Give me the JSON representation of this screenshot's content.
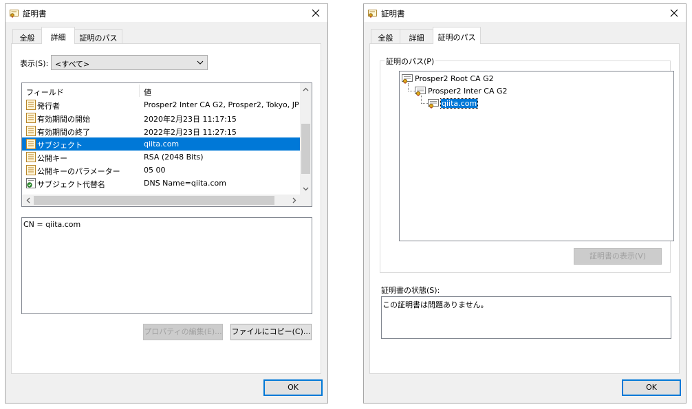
{
  "dialogs": [
    {
      "title": "証明書",
      "tabs": [
        "全般",
        "詳細",
        "証明のパス"
      ],
      "active_tab": "詳細",
      "show_label": "表示(S):",
      "show_value": "<すべて>",
      "list_headers": {
        "field": "フィールド",
        "value": "値"
      },
      "rows": [
        {
          "field": "発行者",
          "value": "Prosper2 Inter CA G2, Prosper2, Tokyo, JP",
          "icon": "certificate-field-icon"
        },
        {
          "field": "有効期間の開始",
          "value": "2020年2月23日 11:17:15",
          "icon": "certificate-field-icon"
        },
        {
          "field": "有効期間の終了",
          "value": "2022年2月23日 11:27:15",
          "icon": "certificate-field-icon"
        },
        {
          "field": "サブジェクト",
          "value": "qiita.com",
          "icon": "certificate-field-icon",
          "selected": true
        },
        {
          "field": "公開キー",
          "value": "RSA (2048 Bits)",
          "icon": "certificate-field-icon"
        },
        {
          "field": "公開キーのパラメーター",
          "value": "05 00",
          "icon": "certificate-field-icon"
        },
        {
          "field": "サブジェクト代替名",
          "value": "DNS Name=qiita.com",
          "icon": "certificate-extension-icon"
        }
      ],
      "detail_text": "CN = qiita.com",
      "buttons": {
        "edit_properties": "プロパティの編集(E)...",
        "copy_to_file": "ファイルにコピー(C)...",
        "ok": "OK"
      }
    },
    {
      "title": "証明書",
      "tabs": [
        "全般",
        "詳細",
        "証明のパス"
      ],
      "active_tab": "証明のパス",
      "path_label": "証明のパス(P)",
      "path": [
        {
          "name": "Prosper2 Root CA G2",
          "level": 0
        },
        {
          "name": "Prosper2 Inter CA G2",
          "level": 1
        },
        {
          "name": "qiita.com",
          "level": 2,
          "selected": true
        }
      ],
      "view_cert_button": "証明書の表示(V)",
      "status_label": "証明書の状態(S):",
      "status_text": "この証明書は問題ありません。",
      "ok": "OK"
    }
  ],
  "colors": {
    "selection": "#0078d7",
    "dialog_bg": "#f0f0f0",
    "default_button_border": "#0078d7"
  }
}
